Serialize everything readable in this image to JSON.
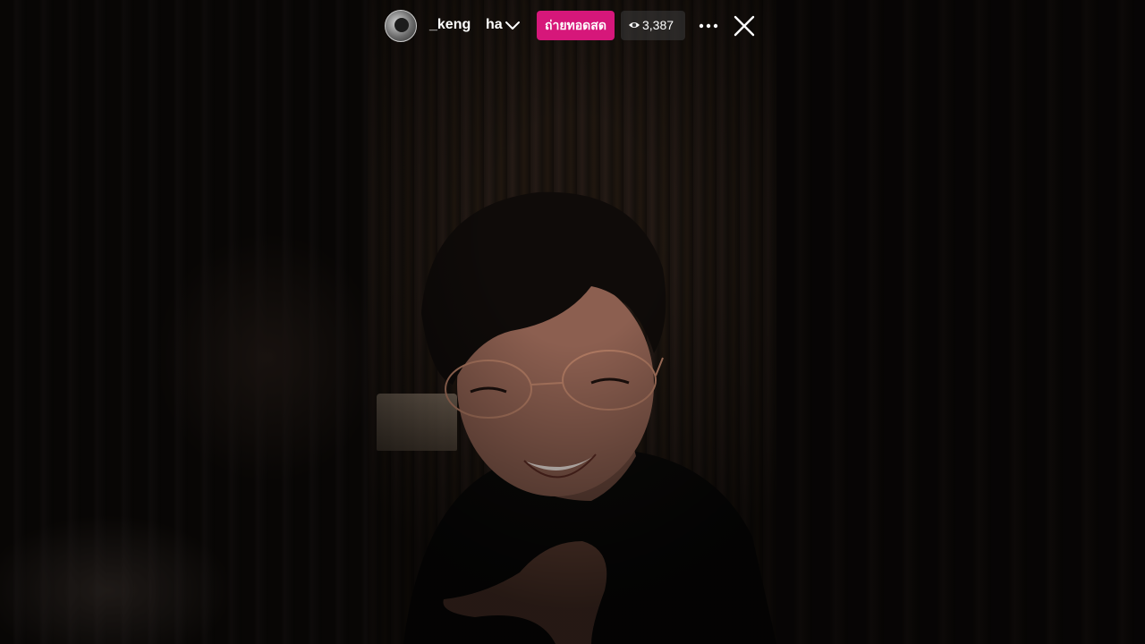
{
  "stream": {
    "username": "_keng",
    "username_suffix": "ha",
    "live_label": "ถ่ายทอดสด",
    "viewer_count": "3,387"
  },
  "icons": {
    "account_switch": "chevron-down-icon",
    "viewers": "eye-icon",
    "more": "more-dots-icon",
    "close": "close-icon"
  },
  "colors": {
    "live_badge": "#d6177a",
    "text": "#ffffff"
  }
}
